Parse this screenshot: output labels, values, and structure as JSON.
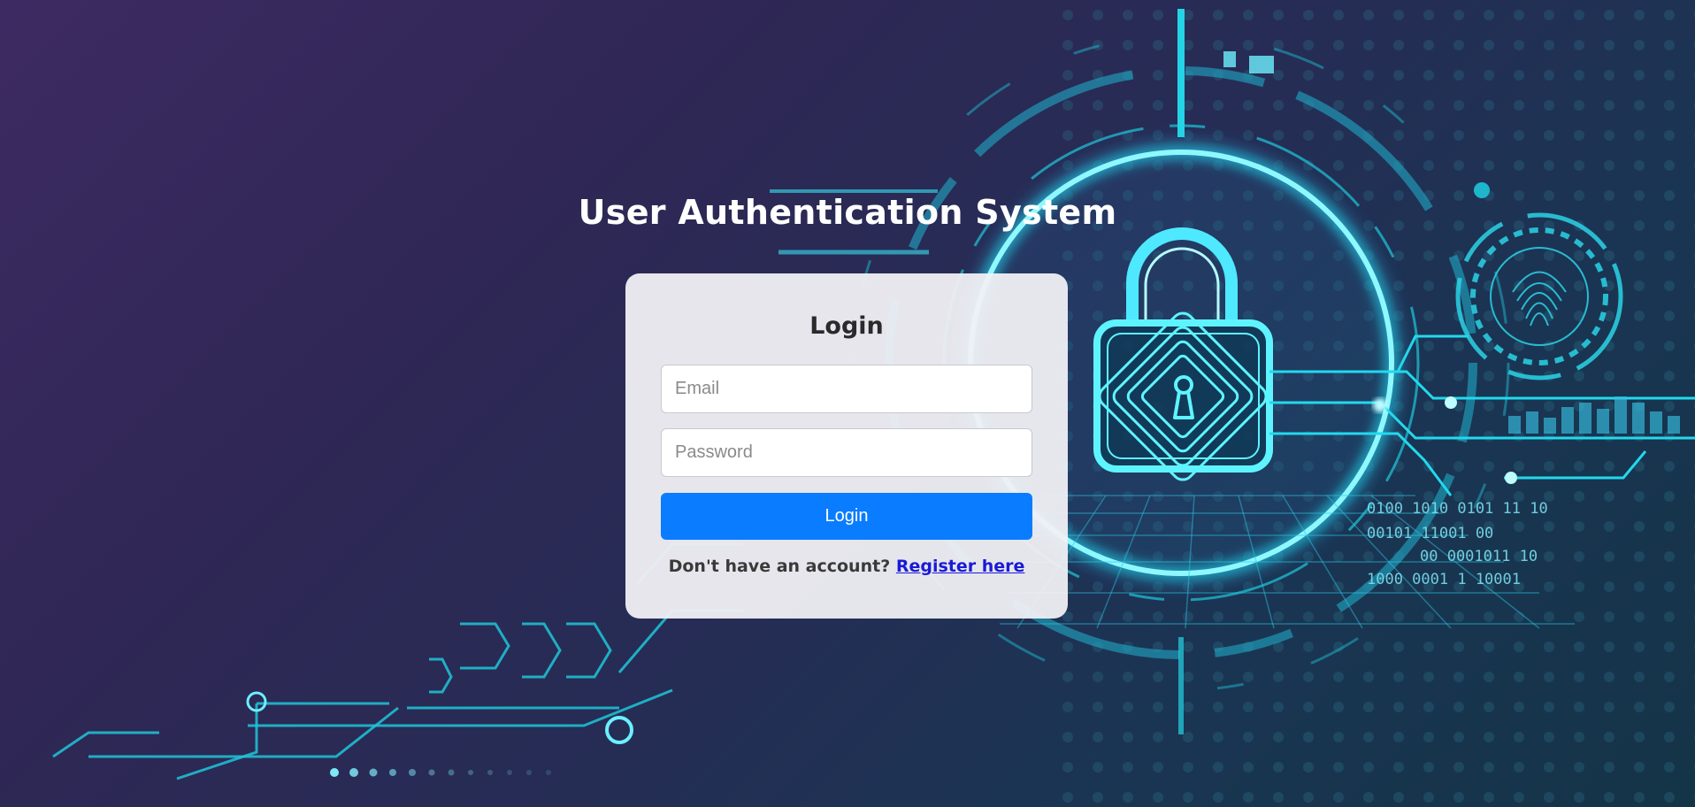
{
  "header": {
    "title": "User Authentication System"
  },
  "login_form": {
    "heading": "Login",
    "email_placeholder": "Email",
    "password_placeholder": "Password",
    "submit_label": "Login",
    "register_prompt": "Don't have an account?",
    "register_link": "Register here"
  },
  "background": {
    "binary_lines": [
      "0100 1010 0101 11 10",
      "00101 11001 00",
      "00 0001011 10",
      "1000 0001 1 10001"
    ],
    "colors": {
      "glow": "#22e5ff",
      "circuit": "#1fc6d8",
      "primary_button": "#0a7cff",
      "link": "#1a1ad6"
    },
    "icons": [
      "padlock-icon",
      "fingerprint-icon"
    ]
  }
}
